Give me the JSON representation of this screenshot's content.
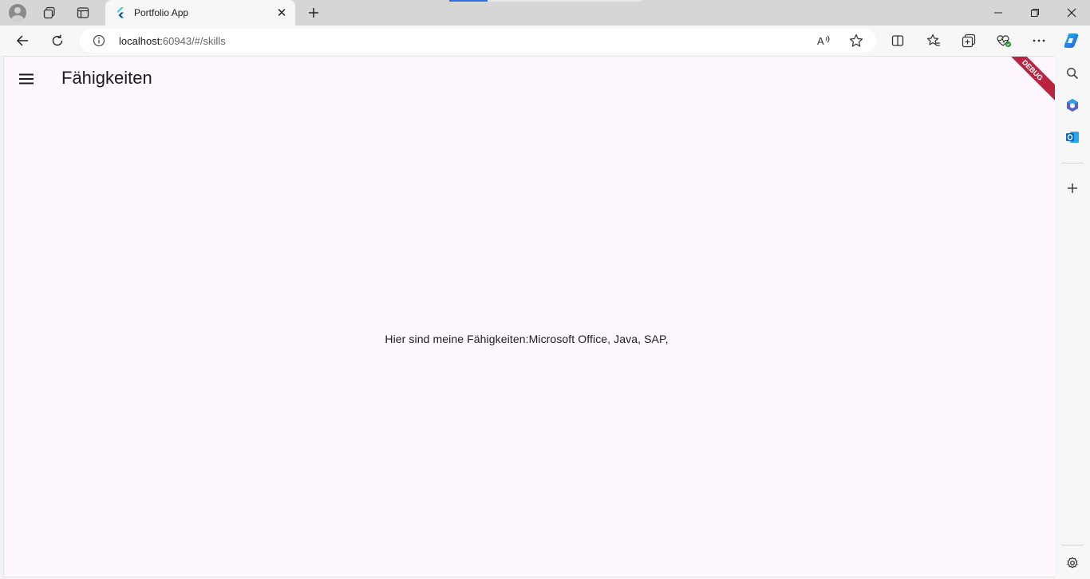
{
  "browser": {
    "tab": {
      "title": "Portfolio App",
      "favicon": "flutter-icon"
    },
    "address_bar": {
      "host": "localhost:",
      "rest": "60943/#/skills"
    },
    "icons": {
      "profile": "profile-avatar-icon",
      "workspaces": "workspaces-icon",
      "tab_actions": "tab-actions-icon",
      "close_tab": "close-icon",
      "new_tab": "plus-icon",
      "minimize": "minimize-icon",
      "restore": "restore-icon",
      "close_window": "close-icon",
      "back": "back-arrow-icon",
      "refresh": "refresh-icon",
      "site_info": "info-icon",
      "read_aloud": "read-aloud-icon",
      "favorite": "star-icon",
      "split_screen": "split-screen-icon",
      "favorites": "favorites-icon",
      "collections": "collections-icon",
      "browser_essentials": "heart-pulse-icon",
      "more": "more-icon",
      "copilot": "copilot-icon"
    },
    "accent_color": "#2f6fdd"
  },
  "sidebar": {
    "icons": [
      "search-icon",
      "copilot-apps-icon",
      "outlook-icon",
      "add-icon",
      "settings-icon"
    ]
  },
  "app": {
    "title": "Fähigkeiten",
    "menu_icon": "hamburger-menu-icon",
    "body_text": "Hier sind meine Fähigkeiten:Microsoft Office, Java, SAP,",
    "debug_label": "DEBUG",
    "background_color": "#fef7fd"
  }
}
